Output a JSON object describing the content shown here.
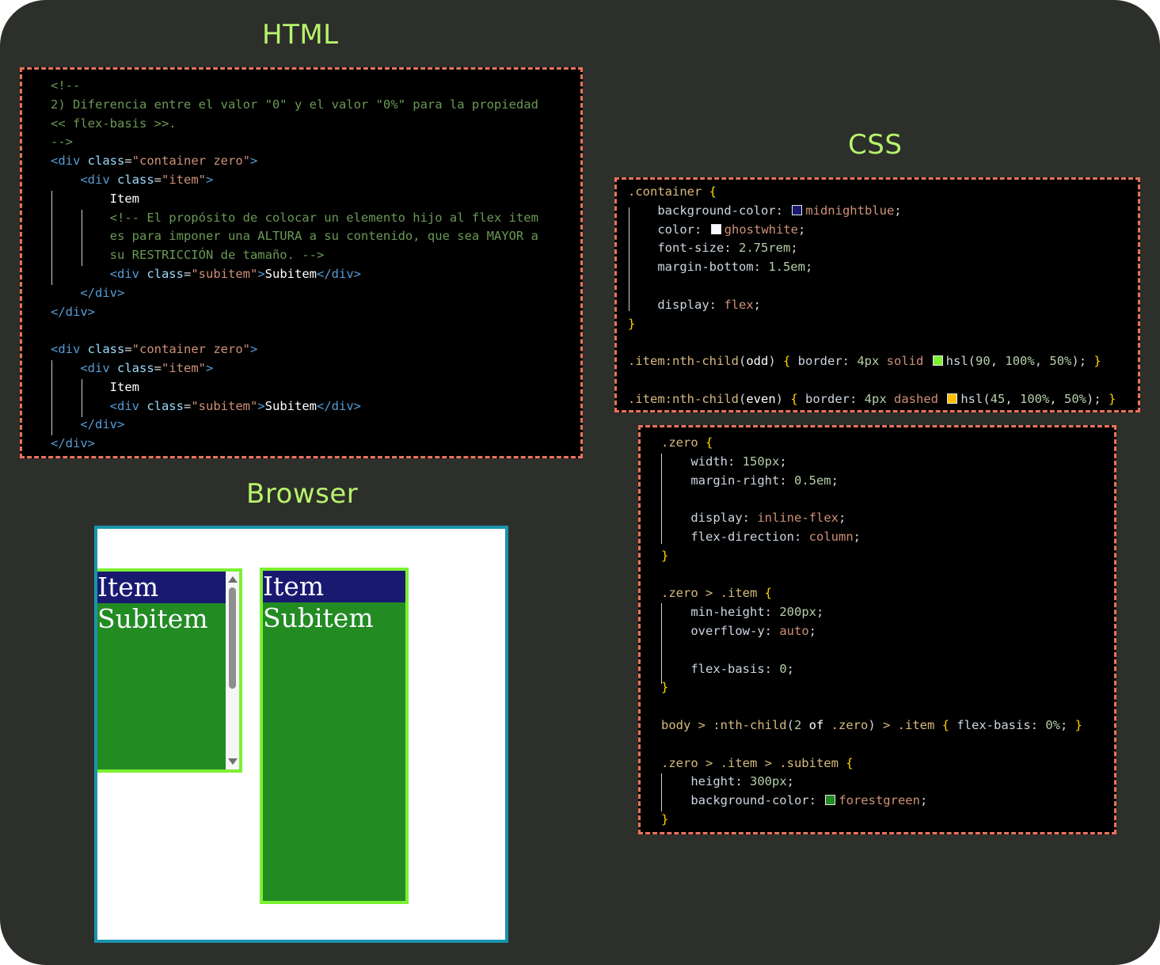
{
  "headings": {
    "html": "HTML",
    "css": "CSS",
    "browser": "Browser"
  },
  "colors": {
    "background": "#2d2f2b",
    "heading": "#b7f36b",
    "panel_border": "#e8735a",
    "browser_border": "#1a93ad",
    "midnightblue": "#191970",
    "ghostwhite": "#f8f8ff",
    "green_border": "#7cf032",
    "orange_swatch": "#ffbf00",
    "forestgreen": "#228b22"
  },
  "html_code": [
    [
      {
        "t": "<!--",
        "c": "com"
      }
    ],
    [
      {
        "t": "2) Diferencia entre el valor \"0\" y el valor \"0%\" para la propiedad",
        "c": "com"
      }
    ],
    [
      {
        "t": "<< flex-basis >>.",
        "c": "com"
      }
    ],
    [
      {
        "t": "-->",
        "c": "com"
      }
    ],
    [
      {
        "t": "<div",
        "c": "tag"
      },
      {
        "t": " class",
        "c": "attr"
      },
      {
        "t": "=",
        "c": "plain"
      },
      {
        "t": "\"container zero\"",
        "c": "str"
      },
      {
        "t": ">",
        "c": "tag"
      }
    ],
    [
      {
        "t": "    <div",
        "c": "tag"
      },
      {
        "t": " class",
        "c": "attr"
      },
      {
        "t": "=",
        "c": "plain"
      },
      {
        "t": "\"item\"",
        "c": "str"
      },
      {
        "t": ">",
        "c": "tag"
      }
    ],
    [
      {
        "t": "        Item",
        "c": "txt"
      }
    ],
    [
      {
        "t": "        <!-- El propósito de colocar un elemento hijo al flex item",
        "c": "com"
      }
    ],
    [
      {
        "t": "        es para imponer una ALTURA a su contenido, que sea MAYOR a",
        "c": "com"
      }
    ],
    [
      {
        "t": "        su RESTRICCIÓN de tamaño. -->",
        "c": "com"
      }
    ],
    [
      {
        "t": "        <div",
        "c": "tag"
      },
      {
        "t": " class",
        "c": "attr"
      },
      {
        "t": "=",
        "c": "plain"
      },
      {
        "t": "\"subitem\"",
        "c": "str"
      },
      {
        "t": ">",
        "c": "tag"
      },
      {
        "t": "Subitem",
        "c": "txt"
      },
      {
        "t": "</div>",
        "c": "tag"
      }
    ],
    [
      {
        "t": "    </div>",
        "c": "tag"
      }
    ],
    [
      {
        "t": "</div>",
        "c": "tag"
      }
    ],
    [
      {
        "t": "",
        "c": "plain"
      }
    ],
    [
      {
        "t": "<div",
        "c": "tag"
      },
      {
        "t": " class",
        "c": "attr"
      },
      {
        "t": "=",
        "c": "plain"
      },
      {
        "t": "\"container zero\"",
        "c": "str"
      },
      {
        "t": ">",
        "c": "tag"
      }
    ],
    [
      {
        "t": "    <div",
        "c": "tag"
      },
      {
        "t": " class",
        "c": "attr"
      },
      {
        "t": "=",
        "c": "plain"
      },
      {
        "t": "\"item\"",
        "c": "str"
      },
      {
        "t": ">",
        "c": "tag"
      }
    ],
    [
      {
        "t": "        Item",
        "c": "txt"
      }
    ],
    [
      {
        "t": "        <div",
        "c": "tag"
      },
      {
        "t": " class",
        "c": "attr"
      },
      {
        "t": "=",
        "c": "plain"
      },
      {
        "t": "\"subitem\"",
        "c": "str"
      },
      {
        "t": ">",
        "c": "tag"
      },
      {
        "t": "Subitem",
        "c": "txt"
      },
      {
        "t": "</div>",
        "c": "tag"
      }
    ],
    [
      {
        "t": "    </div>",
        "c": "tag"
      }
    ],
    [
      {
        "t": "</div>",
        "c": "tag"
      }
    ]
  ],
  "css_code_1": [
    [
      {
        "t": ".container ",
        "c": "sel"
      },
      {
        "t": "{",
        "c": "brace"
      }
    ],
    [
      {
        "t": "    background-color",
        "c": "prop"
      },
      {
        "t": ": ",
        "c": "plain"
      },
      {
        "sw": "#191970"
      },
      {
        "t": "midnightblue",
        "c": "val"
      },
      {
        "t": ";",
        "c": "plain"
      }
    ],
    [
      {
        "t": "    color",
        "c": "prop"
      },
      {
        "t": ": ",
        "c": "plain"
      },
      {
        "sw": "#f8f8ff"
      },
      {
        "t": "ghostwhite",
        "c": "val"
      },
      {
        "t": ";",
        "c": "plain"
      }
    ],
    [
      {
        "t": "    font-size",
        "c": "prop"
      },
      {
        "t": ": ",
        "c": "plain"
      },
      {
        "t": "2.75rem",
        "c": "num"
      },
      {
        "t": ";",
        "c": "plain"
      }
    ],
    [
      {
        "t": "    margin-bottom",
        "c": "prop"
      },
      {
        "t": ": ",
        "c": "plain"
      },
      {
        "t": "1.5em",
        "c": "num"
      },
      {
        "t": ";",
        "c": "plain"
      }
    ],
    [
      {
        "t": "",
        "c": "plain"
      }
    ],
    [
      {
        "t": "    display",
        "c": "prop"
      },
      {
        "t": ": ",
        "c": "plain"
      },
      {
        "t": "flex",
        "c": "val"
      },
      {
        "t": ";",
        "c": "plain"
      }
    ],
    [
      {
        "t": "}",
        "c": "brace"
      }
    ],
    [
      {
        "t": "",
        "c": "plain"
      }
    ],
    [
      {
        "t": ".item:nth-child",
        "c": "sel"
      },
      {
        "t": "(",
        "c": "plain"
      },
      {
        "t": "odd",
        "c": "txt"
      },
      {
        "t": ") ",
        "c": "plain"
      },
      {
        "t": "{",
        "c": "brace"
      },
      {
        "t": " border",
        "c": "prop"
      },
      {
        "t": ": ",
        "c": "plain"
      },
      {
        "t": "4px",
        "c": "num"
      },
      {
        "t": " solid ",
        "c": "val"
      },
      {
        "sw": "#7cf032"
      },
      {
        "t": "hsl",
        "c": "prop"
      },
      {
        "t": "(",
        "c": "plain"
      },
      {
        "t": "90",
        "c": "num"
      },
      {
        "t": ", ",
        "c": "plain"
      },
      {
        "t": "100%",
        "c": "num"
      },
      {
        "t": ", ",
        "c": "plain"
      },
      {
        "t": "50%",
        "c": "num"
      },
      {
        "t": "); ",
        "c": "plain"
      },
      {
        "t": "}",
        "c": "brace"
      }
    ],
    [
      {
        "t": "",
        "c": "plain"
      }
    ],
    [
      {
        "t": ".item:nth-child",
        "c": "sel"
      },
      {
        "t": "(",
        "c": "plain"
      },
      {
        "t": "even",
        "c": "txt"
      },
      {
        "t": ") ",
        "c": "plain"
      },
      {
        "t": "{",
        "c": "brace"
      },
      {
        "t": " border",
        "c": "prop"
      },
      {
        "t": ": ",
        "c": "plain"
      },
      {
        "t": "4px",
        "c": "num"
      },
      {
        "t": " dashed ",
        "c": "val"
      },
      {
        "sw": "#ffbf00"
      },
      {
        "t": "hsl",
        "c": "prop"
      },
      {
        "t": "(",
        "c": "plain"
      },
      {
        "t": "45",
        "c": "num"
      },
      {
        "t": ", ",
        "c": "plain"
      },
      {
        "t": "100%",
        "c": "num"
      },
      {
        "t": ", ",
        "c": "plain"
      },
      {
        "t": "50%",
        "c": "num"
      },
      {
        "t": "); ",
        "c": "plain"
      },
      {
        "t": "}",
        "c": "brace"
      }
    ]
  ],
  "css_code_2": [
    [
      {
        "t": ".zero ",
        "c": "sel"
      },
      {
        "t": "{",
        "c": "brace"
      }
    ],
    [
      {
        "t": "    width",
        "c": "prop"
      },
      {
        "t": ": ",
        "c": "plain"
      },
      {
        "t": "150px",
        "c": "num"
      },
      {
        "t": ";",
        "c": "plain"
      }
    ],
    [
      {
        "t": "    margin-right",
        "c": "prop"
      },
      {
        "t": ": ",
        "c": "plain"
      },
      {
        "t": "0.5em",
        "c": "num"
      },
      {
        "t": ";",
        "c": "plain"
      }
    ],
    [
      {
        "t": "",
        "c": "plain"
      }
    ],
    [
      {
        "t": "    display",
        "c": "prop"
      },
      {
        "t": ": ",
        "c": "plain"
      },
      {
        "t": "inline-flex",
        "c": "val"
      },
      {
        "t": ";",
        "c": "plain"
      }
    ],
    [
      {
        "t": "    flex-direction",
        "c": "prop"
      },
      {
        "t": ": ",
        "c": "plain"
      },
      {
        "t": "column",
        "c": "val"
      },
      {
        "t": ";",
        "c": "plain"
      }
    ],
    [
      {
        "t": "}",
        "c": "brace"
      }
    ],
    [
      {
        "t": "",
        "c": "plain"
      }
    ],
    [
      {
        "t": ".zero > .item ",
        "c": "sel"
      },
      {
        "t": "{",
        "c": "brace"
      }
    ],
    [
      {
        "t": "    min-height",
        "c": "prop"
      },
      {
        "t": ": ",
        "c": "plain"
      },
      {
        "t": "200px",
        "c": "num"
      },
      {
        "t": ";",
        "c": "plain"
      }
    ],
    [
      {
        "t": "    overflow-y",
        "c": "prop"
      },
      {
        "t": ": ",
        "c": "plain"
      },
      {
        "t": "auto",
        "c": "val"
      },
      {
        "t": ";",
        "c": "plain"
      }
    ],
    [
      {
        "t": "",
        "c": "plain"
      }
    ],
    [
      {
        "t": "    flex-basis",
        "c": "prop"
      },
      {
        "t": ": ",
        "c": "plain"
      },
      {
        "t": "0",
        "c": "num"
      },
      {
        "t": ";",
        "c": "plain"
      }
    ],
    [
      {
        "t": "}",
        "c": "brace"
      }
    ],
    [
      {
        "t": "",
        "c": "plain"
      }
    ],
    [
      {
        "t": "body > :nth-child",
        "c": "sel"
      },
      {
        "t": "(",
        "c": "plain"
      },
      {
        "t": "2",
        "c": "num"
      },
      {
        "t": " of ",
        "c": "txt"
      },
      {
        "t": ".zero",
        "c": "sel"
      },
      {
        "t": ") ",
        "c": "plain"
      },
      {
        "t": "> .item ",
        "c": "sel"
      },
      {
        "t": "{",
        "c": "brace"
      },
      {
        "t": " flex-basis",
        "c": "prop"
      },
      {
        "t": ": ",
        "c": "plain"
      },
      {
        "t": "0%",
        "c": "num"
      },
      {
        "t": "; ",
        "c": "plain"
      },
      {
        "t": "}",
        "c": "brace"
      }
    ],
    [
      {
        "t": "",
        "c": "plain"
      }
    ],
    [
      {
        "t": ".zero > .item > .subitem ",
        "c": "sel"
      },
      {
        "t": "{",
        "c": "brace"
      }
    ],
    [
      {
        "t": "    height",
        "c": "prop"
      },
      {
        "t": ": ",
        "c": "plain"
      },
      {
        "t": "300px",
        "c": "num"
      },
      {
        "t": ";",
        "c": "plain"
      }
    ],
    [
      {
        "t": "    background-color",
        "c": "prop"
      },
      {
        "t": ": ",
        "c": "plain"
      },
      {
        "sw": "#228b22"
      },
      {
        "t": "forestgreen",
        "c": "val"
      },
      {
        "t": ";",
        "c": "plain"
      }
    ],
    [
      {
        "t": "}",
        "c": "brace"
      }
    ]
  ],
  "browser_preview": {
    "items": [
      {
        "label": "Item",
        "sublabel": "Subitem",
        "scrollbar": true
      },
      {
        "label": "Item",
        "sublabel": "Subitem",
        "scrollbar": false
      }
    ]
  }
}
